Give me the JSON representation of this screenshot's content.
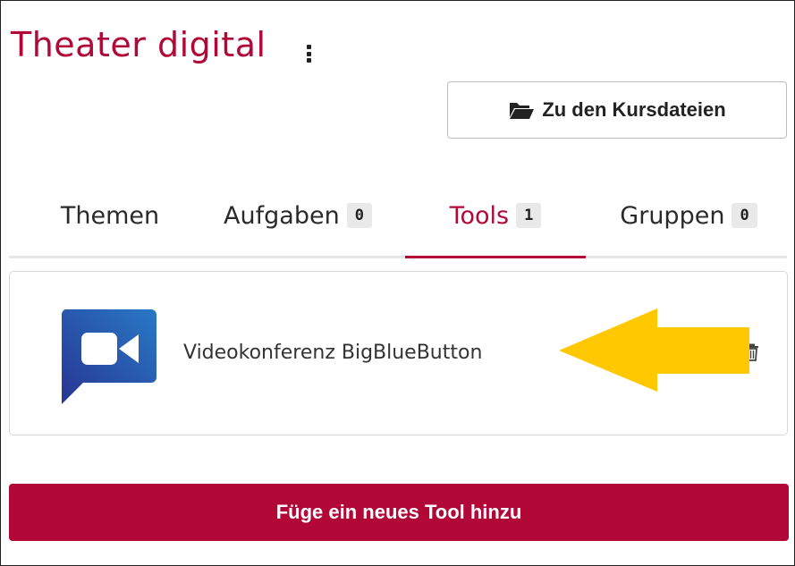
{
  "course": {
    "title": "Theater digital",
    "menu_icon": "kebab-vertical-icon"
  },
  "files_button": {
    "icon": "folder-open-icon",
    "label": "Zu den Kursdateien"
  },
  "tabs": [
    {
      "label": "Themen",
      "count": null,
      "active": false
    },
    {
      "label": "Aufgaben",
      "count": "0",
      "active": false
    },
    {
      "label": "Tools",
      "count": "1",
      "active": true
    },
    {
      "label": "Gruppen",
      "count": "0",
      "active": false
    }
  ],
  "tools": [
    {
      "label": "Videokonferenz BigBlueButton",
      "icon": "video-camera-chat-icon",
      "action_icon": "trash-icon"
    }
  ],
  "annotation": {
    "icon": "arrow-left-icon",
    "color": "#ffc800"
  },
  "add_tool_button": {
    "label": "Füge ein neues Tool hinzu"
  },
  "colors": {
    "accent": "#b10838",
    "badge_bg": "#e9e9e9",
    "tab_underline": "#e6e6e6"
  }
}
